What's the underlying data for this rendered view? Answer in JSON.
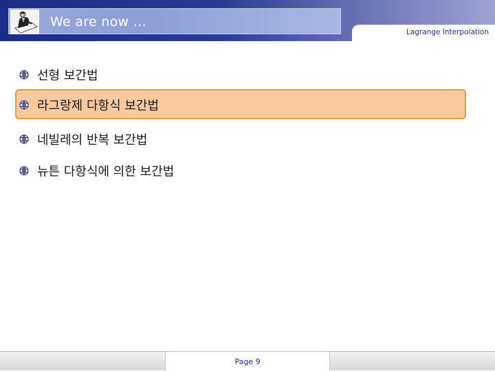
{
  "header": {
    "title": "We are now …",
    "topic_label": "Lagrange Interpolation",
    "icon": "reader-figure-icon"
  },
  "bullets": [
    {
      "text": "선형 보간법",
      "highlighted": false
    },
    {
      "text": "라그랑제 다항식 보간법",
      "highlighted": true
    },
    {
      "text": "네빌레의 반복 보간법",
      "highlighted": false
    },
    {
      "text": "뉴튼 다항식에 의한 보간법",
      "highlighted": false
    }
  ],
  "bullet_icon": "globe-bullet-icon",
  "footer": {
    "page_label": "Page 9"
  },
  "colors": {
    "header_blue": "#1a2d86",
    "highlight_fill": "#f9c89d",
    "highlight_border": "#d9a236",
    "title_box": "#9aa9d9"
  }
}
